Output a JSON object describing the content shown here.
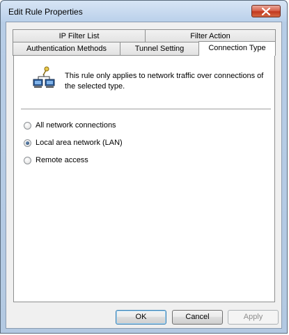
{
  "window": {
    "title": "Edit Rule Properties",
    "close_icon": "close-icon"
  },
  "tabs": {
    "row1": [
      {
        "label": "IP Filter List"
      },
      {
        "label": "Filter Action"
      }
    ],
    "row2": [
      {
        "label": "Authentication Methods"
      },
      {
        "label": "Tunnel Setting"
      },
      {
        "label": "Connection Type",
        "active": true
      }
    ]
  },
  "panel": {
    "icon": "network-connection-icon",
    "description": "This rule only applies to network traffic over connections of the selected type.",
    "options": [
      {
        "label": "All network connections",
        "checked": false
      },
      {
        "label": "Local area network (LAN)",
        "checked": true
      },
      {
        "label": "Remote access",
        "checked": false
      }
    ]
  },
  "buttons": {
    "ok": "OK",
    "cancel": "Cancel",
    "apply": "Apply",
    "apply_enabled": false
  }
}
